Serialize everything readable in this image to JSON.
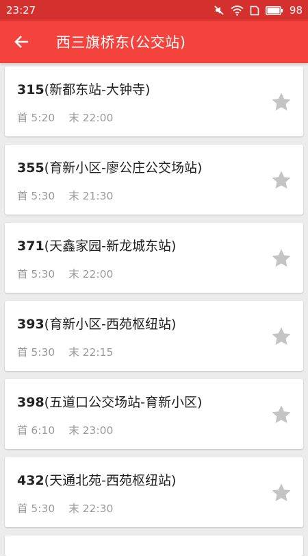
{
  "status_bar": {
    "time": "23:27",
    "battery": "98"
  },
  "header": {
    "title": "西三旗桥东(公交站)"
  },
  "routes": [
    {
      "number": "315",
      "route": "(新都东站-大钟寺)",
      "first": "首 5:20",
      "last": "末 22:00"
    },
    {
      "number": "355",
      "route": "(育新小区-廖公庄公交场站)",
      "first": "首 5:30",
      "last": "末 21:30"
    },
    {
      "number": "371",
      "route": "(天鑫家园-新龙城东站)",
      "first": "首 5:30",
      "last": "末 22:00"
    },
    {
      "number": "393",
      "route": "(育新小区-西苑枢纽站)",
      "first": "首 5:30",
      "last": "末 22:15"
    },
    {
      "number": "398",
      "route": "(五道口公交场站-育新小区)",
      "first": "首 6:10",
      "last": "末 23:00"
    },
    {
      "number": "432",
      "route": "(天通北苑-西苑枢纽站)",
      "first": "首 5:30",
      "last": "末 22:30"
    }
  ],
  "colors": {
    "status_bar": "#d4302e",
    "app_bar": "#f4423d",
    "background": "#ececec",
    "star": "#c4c4c4"
  },
  "icons": {
    "back": "arrow-left-icon",
    "star": "star-icon",
    "mute": "mute-icon",
    "wifi": "wifi-icon",
    "sim": "sim-card-icon",
    "battery": "battery-icon"
  }
}
